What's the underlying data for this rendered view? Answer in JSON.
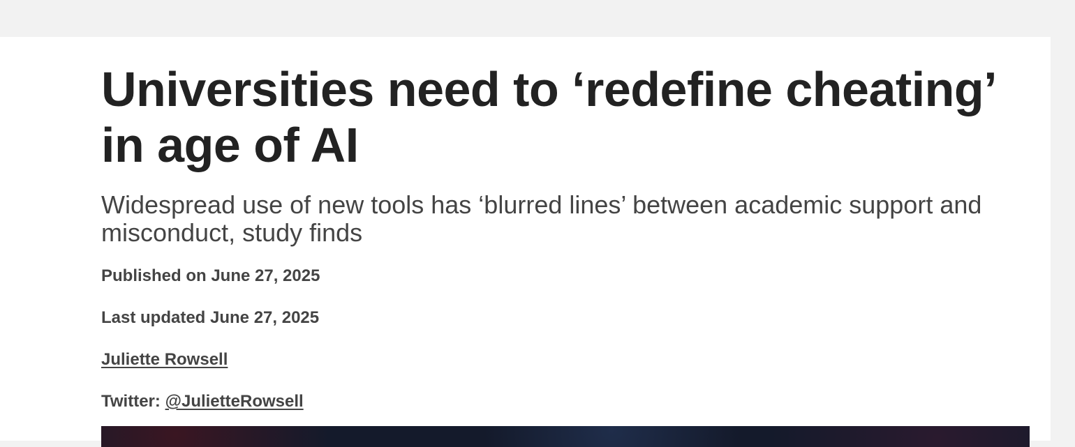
{
  "article": {
    "headline": "Universities need to ‘redefine cheating’ in age of AI",
    "standfirst": "Widespread use of new tools has ‘blurred lines’ between academic support and misconduct, study finds",
    "published": "Published on June 27, 2025",
    "updated": "Last updated June 27, 2025",
    "author": "Juliette Rowsell",
    "twitter_label": "Twitter:",
    "twitter_handle": "@JulietteRowsell"
  },
  "colors": {
    "page_background": "#f2f2f2",
    "card_background": "#ffffff",
    "headline_text": "#222222",
    "body_text": "#444444",
    "hero_image_dark": "#141a2b"
  }
}
